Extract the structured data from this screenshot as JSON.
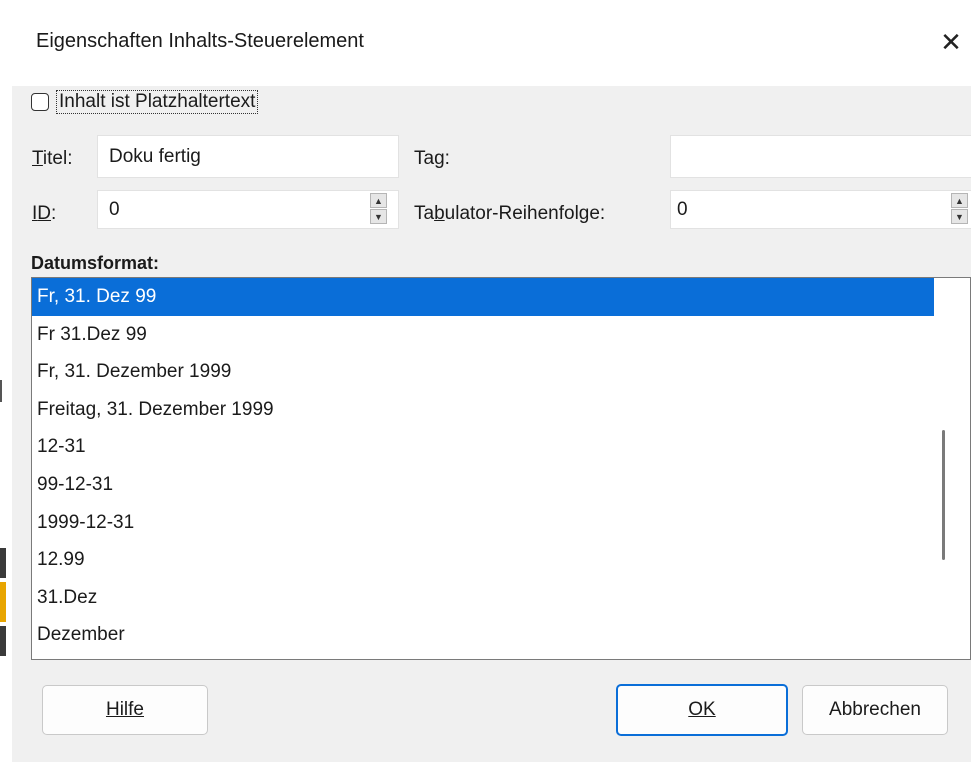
{
  "window": {
    "title": "Eigenschaften Inhalts-Steuerelement",
    "close_glyph": "✕"
  },
  "checkbox": {
    "label": "Inhalt ist Platzhaltertext",
    "checked": false
  },
  "fields": {
    "title_label": "Titel:",
    "title_value": "Doku fertig",
    "tag_label": "Tag:",
    "tag_value": "",
    "id_label": "ID:",
    "id_value": "0",
    "tab_order_label": "Tabulator-Reihenfolge:",
    "tab_order_value": "0"
  },
  "date_format": {
    "heading": "Datumsformat:",
    "items": [
      "Fr, 31. Dez 99",
      "Fr 31.Dez 99",
      "Fr, 31. Dezember 1999",
      "Freitag, 31. Dezember 1999",
      "12-31",
      "99-12-31",
      "1999-12-31",
      "12.99",
      "31.Dez",
      "Dezember"
    ],
    "selected_index": 0
  },
  "buttons": {
    "help": "Hilfe",
    "ok": "OK",
    "cancel": "Abbrechen"
  },
  "colors": {
    "accent": "#0a6ed8",
    "dialog_bg": "#f0f0f0"
  },
  "icons": {
    "close": "close-icon",
    "spin_up": "spin-up-icon",
    "spin_down": "spin-down-icon"
  }
}
